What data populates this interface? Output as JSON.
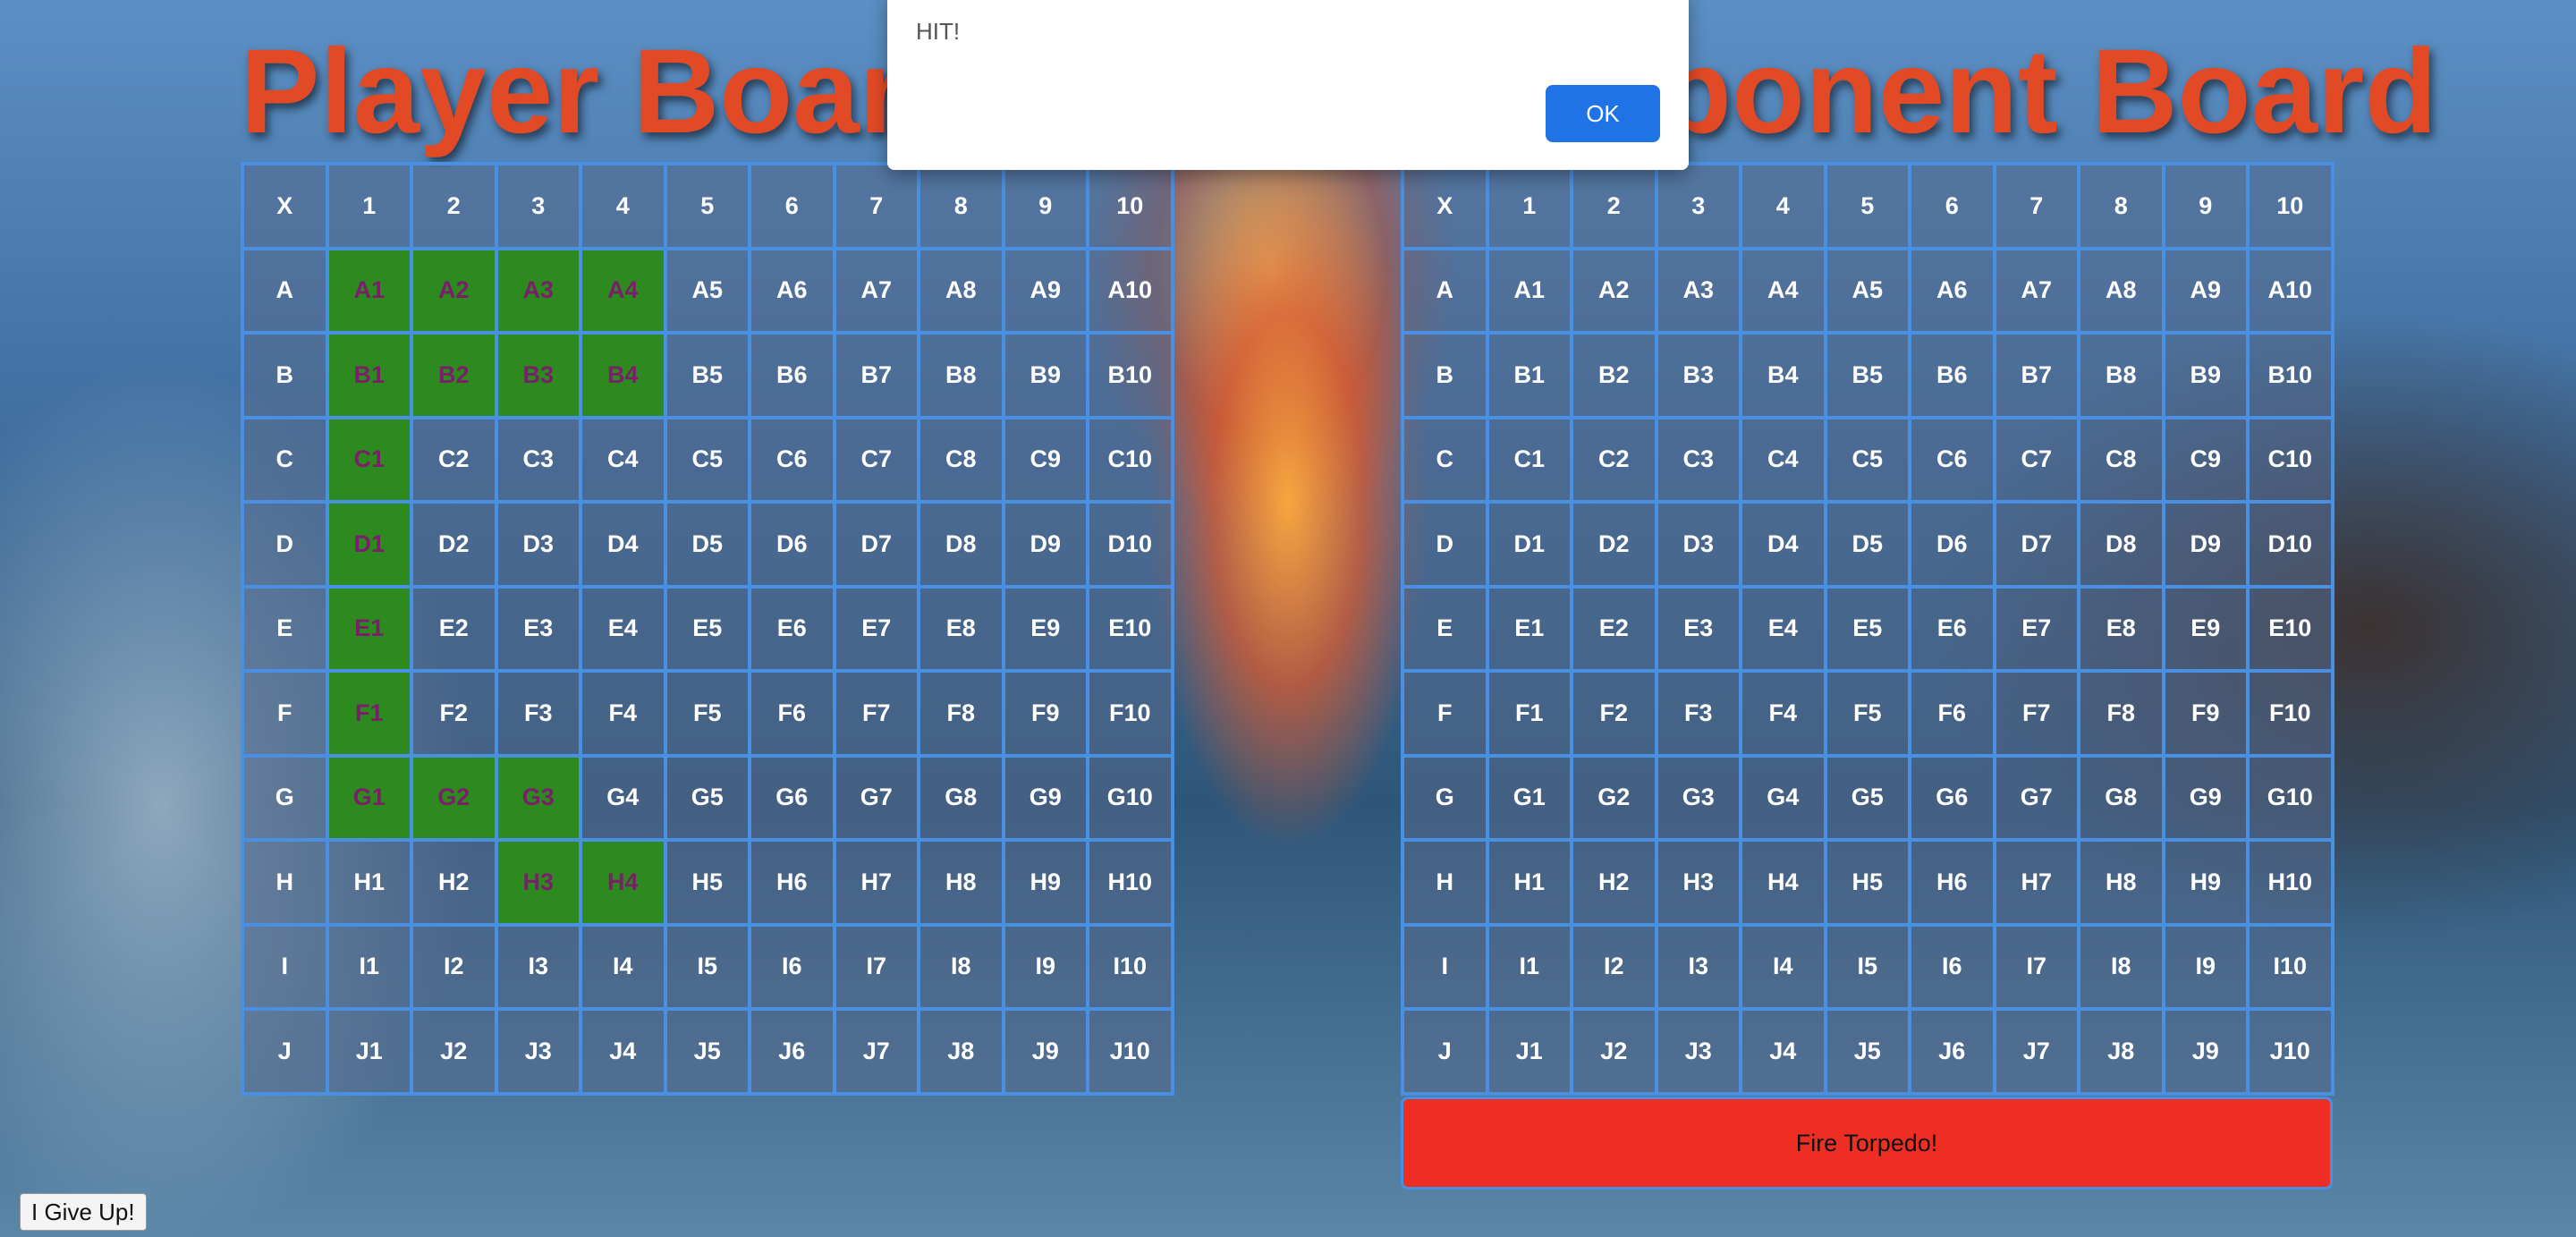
{
  "player_board": {
    "title": "Player Board",
    "columns": [
      "X",
      "1",
      "2",
      "3",
      "4",
      "5",
      "6",
      "7",
      "8",
      "9",
      "10"
    ],
    "rows": [
      "A",
      "B",
      "C",
      "D",
      "E",
      "F",
      "G",
      "H",
      "I",
      "J"
    ],
    "ship_cells": [
      "A1",
      "A2",
      "A3",
      "A4",
      "B1",
      "B2",
      "B3",
      "B4",
      "C1",
      "D1",
      "E1",
      "F1",
      "G1",
      "G2",
      "G3",
      "H3",
      "H4"
    ]
  },
  "opponent_board": {
    "title": "Opponent Board",
    "columns": [
      "X",
      "1",
      "2",
      "3",
      "4",
      "5",
      "6",
      "7",
      "8",
      "9",
      "10"
    ],
    "rows": [
      "A",
      "B",
      "C",
      "D",
      "E",
      "F",
      "G",
      "H",
      "I",
      "J"
    ]
  },
  "fire_button": {
    "label": "Fire Torpedo!"
  },
  "give_up_button": {
    "label": "I Give Up!"
  },
  "alert": {
    "message": "HIT!",
    "ok_label": "OK"
  },
  "colors": {
    "ship": "#2d8a1e",
    "grid_line": "#4a90e2",
    "title": "#e24a25",
    "fire": "#ee2e22",
    "ok": "#1f73e6"
  }
}
